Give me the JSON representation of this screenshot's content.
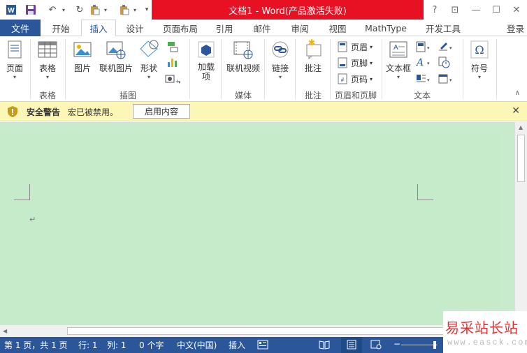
{
  "window": {
    "title": "文档1 - Word(产品激活失败)",
    "help": "?",
    "restore_ribbon": "⊡",
    "minimize": "—",
    "maximize": "☐",
    "close": "✕"
  },
  "tabs": {
    "file": "文件",
    "items": [
      "开始",
      "插入",
      "设计",
      "页面布局",
      "引用",
      "邮件",
      "审阅",
      "视图",
      "MathType",
      "开发工具"
    ],
    "active": "插入",
    "login": "登录"
  },
  "ribbon": {
    "page": "页面",
    "table": "表格",
    "picture": "图片",
    "online_picture": "联机图片",
    "shapes": "形状",
    "addins": "加载项",
    "addins_line1": "加载",
    "addins_line2": "项",
    "online_video": "联机视频",
    "link": "链接",
    "comment": "批注",
    "header": "页眉",
    "footer": "页脚",
    "page_number": "页码",
    "textbox": "文本框",
    "symbol": "符号",
    "groups": {
      "table": "表格",
      "illustrations": "插图",
      "media": "媒体",
      "comments": "批注",
      "header_footer": "页眉和页脚",
      "text": "文本"
    }
  },
  "message_bar": {
    "title": "安全警告",
    "text": "宏已被禁用。",
    "button": "启用内容"
  },
  "document": {
    "paragraph_mark": "↵"
  },
  "status_bar": {
    "page": "第 1 页，共 1 页",
    "row": "行: 1",
    "col": "列: 1",
    "words": "0 个字",
    "language": "中文(中国)",
    "mode": "插入"
  },
  "watermark": {
    "name": "易采站长站",
    "url": "www.easck.com"
  },
  "colors": {
    "word_blue": "#2b579a",
    "title_red": "#e81123",
    "doc_green": "#c8ebcd",
    "warning_yellow": "#fcf7b6"
  }
}
